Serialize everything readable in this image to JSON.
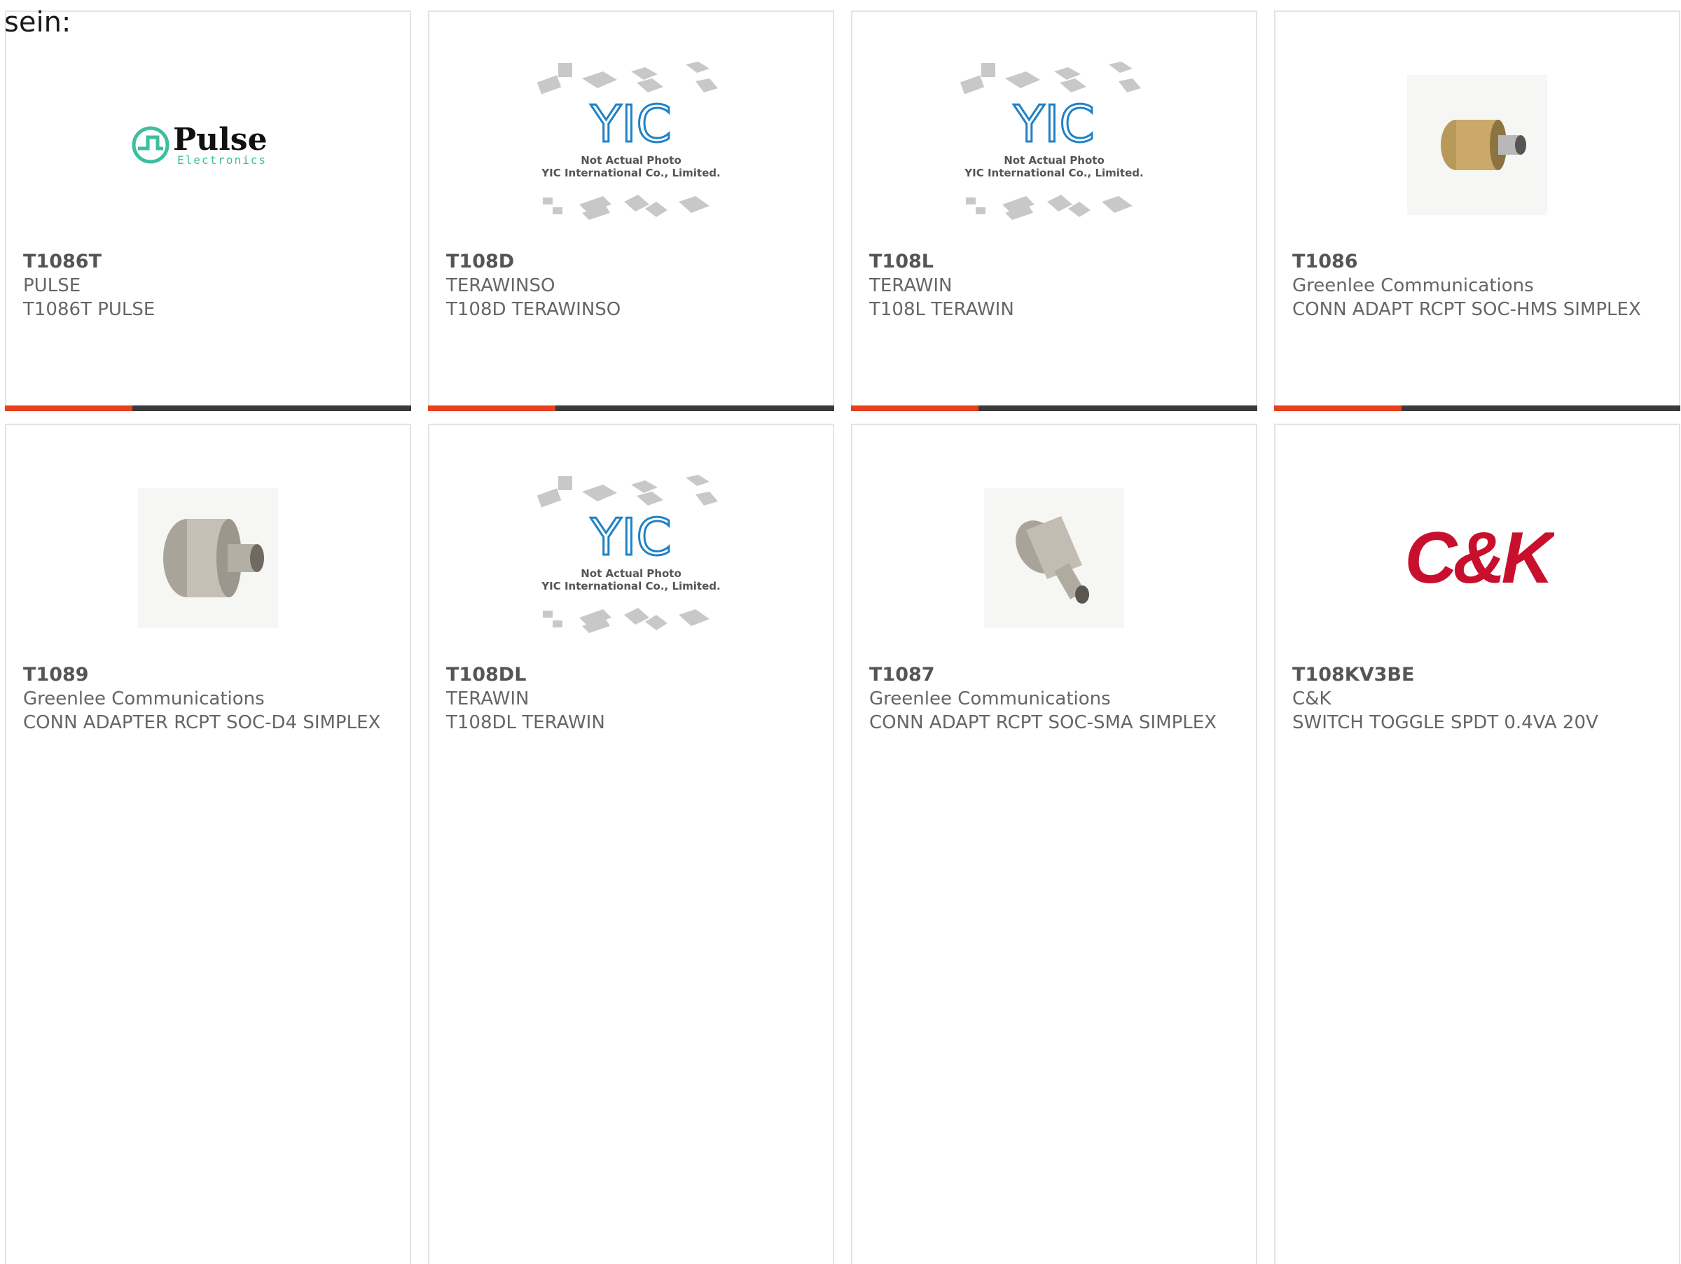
{
  "fragment": "sein:",
  "colors": {
    "accent": "#e8401c",
    "bar": "#3a3a3a",
    "yic_blue": "#1f82c6",
    "pulse_teal": "#3cbf9e",
    "ck_red": "#c8102e"
  },
  "placeholder": {
    "line1": "Not Actual Photo",
    "line2": "YIC International Co., Limited."
  },
  "logos": {
    "pulse_main": "Pulse",
    "pulse_sub": "Electronics",
    "ck": "C&K",
    "yic": "YIC"
  },
  "products": [
    {
      "part": "T1086T",
      "maker": "PULSE",
      "desc": "T1086T PULSE",
      "image": "pulse-logo"
    },
    {
      "part": "T108D",
      "maker": "TERAWINSO",
      "desc": "T108D TERAWINSO",
      "image": "yic-placeholder"
    },
    {
      "part": "T108L",
      "maker": "TERAWIN",
      "desc": "T108L TERAWIN",
      "image": "yic-placeholder"
    },
    {
      "part": "T1086",
      "maker": "Greenlee Communications",
      "desc": "CONN ADAPT RCPT SOC-HMS SIMPLEX",
      "image": "connector-photo"
    },
    {
      "part": "T1089",
      "maker": "Greenlee Communications",
      "desc": "CONN ADAPTER RCPT SOC-D4 SIMPLEX",
      "image": "connector-photo"
    },
    {
      "part": "T108DL",
      "maker": "TERAWIN",
      "desc": "T108DL TERAWIN",
      "image": "yic-placeholder"
    },
    {
      "part": "T1087",
      "maker": "Greenlee Communications",
      "desc": "CONN ADAPT RCPT SOC-SMA SIMPLEX",
      "image": "connector-photo"
    },
    {
      "part": "T108KV3BE",
      "maker": "C&K",
      "desc": "SWITCH TOGGLE SPDT 0.4VA 20V",
      "image": "ck-logo"
    }
  ]
}
